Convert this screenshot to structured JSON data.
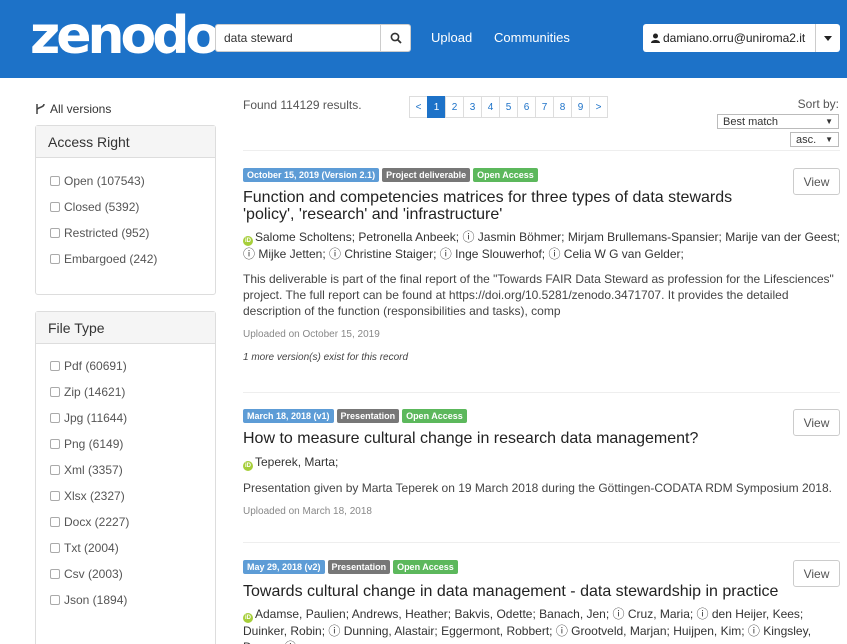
{
  "header": {
    "logo": "zenodo",
    "search_value": "data steward",
    "search_icon": "search-icon",
    "links": [
      "Upload",
      "Communities"
    ],
    "user_email": "damiano.orru@uniroma2.it",
    "user_icon": "user-icon",
    "caret_icon": "caret-down-icon",
    "bg_color": "#1d72c8"
  },
  "sidebar": {
    "all_versions": "All versions",
    "access_right": {
      "title": "Access Right",
      "items": [
        "Open (107543)",
        "Closed (5392)",
        "Restricted (952)",
        "Embargoed (242)"
      ]
    },
    "file_type": {
      "title": "File Type",
      "items": [
        "Pdf (60691)",
        "Zip (14621)",
        "Jpg (11644)",
        "Png (6149)",
        "Xml (3357)",
        "Xlsx (2327)",
        "Docx (2227)",
        "Txt (2004)",
        "Csv (2003)",
        "Json (1894)"
      ]
    }
  },
  "results": {
    "found": "Found 114129 results.",
    "pages": [
      "<",
      "1",
      "2",
      "3",
      "4",
      "5",
      "6",
      "7",
      "8",
      "9",
      ">"
    ],
    "active_page": "1",
    "sort_label": "Sort by:",
    "sort_value": "Best match",
    "order_value": "asc."
  },
  "records": [
    {
      "date": "October 15, 2019 (Version 2.1)",
      "type": "Project deliverable",
      "access": "Open Access",
      "title": "Function and competencies matrices for three types of data stewards 'policy', 'research' and 'infrastructure'",
      "authors": "Salome Scholtens; Petronella Anbeek; ⓘ Jasmin Böhmer; Mirjam Brullemans-Spansier; Marije van der Geest; ⓘ Mijke Jetten; ⓘ Christine Staiger; ⓘ Inge Slouwerhof; ⓘ Celia W G van Gelder;",
      "description": "This deliverable is part of the final report of the \"Towards FAIR Data Steward as profession for the Lifesciences\" project. The full report can be found at https://doi.org/10.5281/zenodo.3471707. It provides the detailed description of the function (responsibilities and tasks), comp",
      "uploaded": "Uploaded on October 15, 2019",
      "versions": "1 more version(s) exist for this record",
      "view": "View"
    },
    {
      "date": "March 18, 2018 (v1)",
      "type": "Presentation",
      "access": "Open Access",
      "title": "How to measure cultural change in research data management?",
      "authors": "Teperek, Marta;",
      "description": "Presentation given by Marta Teperek on 19 March 2018 during the Göttingen-CODATA RDM Symposium 2018.",
      "uploaded": "Uploaded on March 18, 2018",
      "view": "View"
    },
    {
      "date": "May 29, 2018 (v2)",
      "type": "Presentation",
      "access": "Open Access",
      "title": "Towards cultural change in data management - data stewardship in practice",
      "authors": "Adamse, Paulien; Andrews, Heather; Bakvis, Odette; Banach, Jen; ⓘ Cruz, Maria; ⓘ den Heijer, Kees; Duinker, Robin; ⓘ Dunning, Alastair; Eggermont, Robbert; ⓘ Grootveld, Marjan; Huijpen, Kim; ⓘ Kingsley, Danny; ⓘ",
      "view": "View"
    }
  ]
}
